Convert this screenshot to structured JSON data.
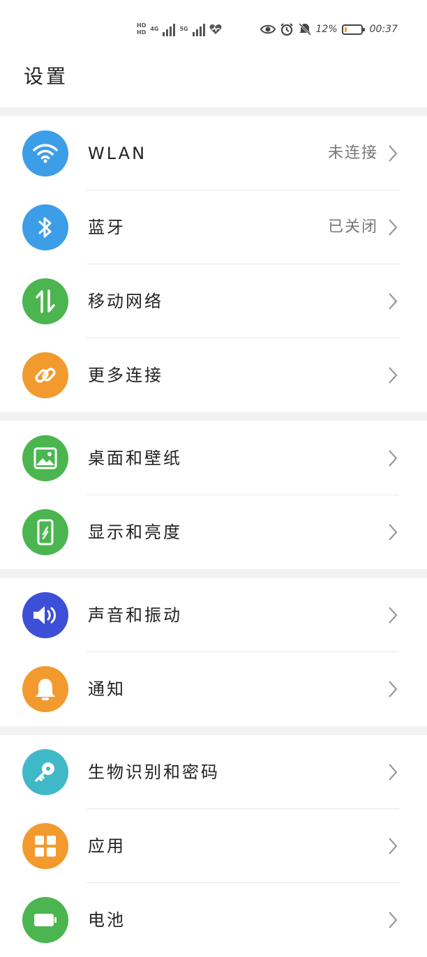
{
  "status_bar": {
    "hd1": "HD",
    "hd2": "HD",
    "net1": "4G",
    "net2": "5G",
    "battery_percent": "12%",
    "time": "00:37",
    "battery_level": 0.12
  },
  "page": {
    "title": "设置"
  },
  "rows": [
    {
      "label": "WLAN",
      "value": "未连接",
      "icon": "wifi-icon",
      "color": "#3d9ee8"
    },
    {
      "label": "蓝牙",
      "value": "已关闭",
      "icon": "bluetooth-icon",
      "color": "#3d9ee8"
    },
    {
      "label": "移动网络",
      "value": "",
      "icon": "mobile-data-icon",
      "color": "#4bb54f"
    },
    {
      "label": "更多连接",
      "value": "",
      "icon": "link-icon",
      "color": "#f29a2e"
    },
    {
      "label": "桌面和壁纸",
      "value": "",
      "icon": "image-icon",
      "color": "#4bb54f"
    },
    {
      "label": "显示和亮度",
      "value": "",
      "icon": "display-icon",
      "color": "#4bb54f"
    },
    {
      "label": "声音和振动",
      "value": "",
      "icon": "speaker-icon",
      "color": "#3c4fd6"
    },
    {
      "label": "通知",
      "value": "",
      "icon": "bell-icon",
      "color": "#f29a2e"
    },
    {
      "label": "生物识别和密码",
      "value": "",
      "icon": "key-icon",
      "color": "#3fb8c8"
    },
    {
      "label": "应用",
      "value": "",
      "icon": "apps-icon",
      "color": "#f29a2e"
    },
    {
      "label": "电池",
      "value": "",
      "icon": "battery-icon",
      "color": "#4bb54f"
    }
  ]
}
